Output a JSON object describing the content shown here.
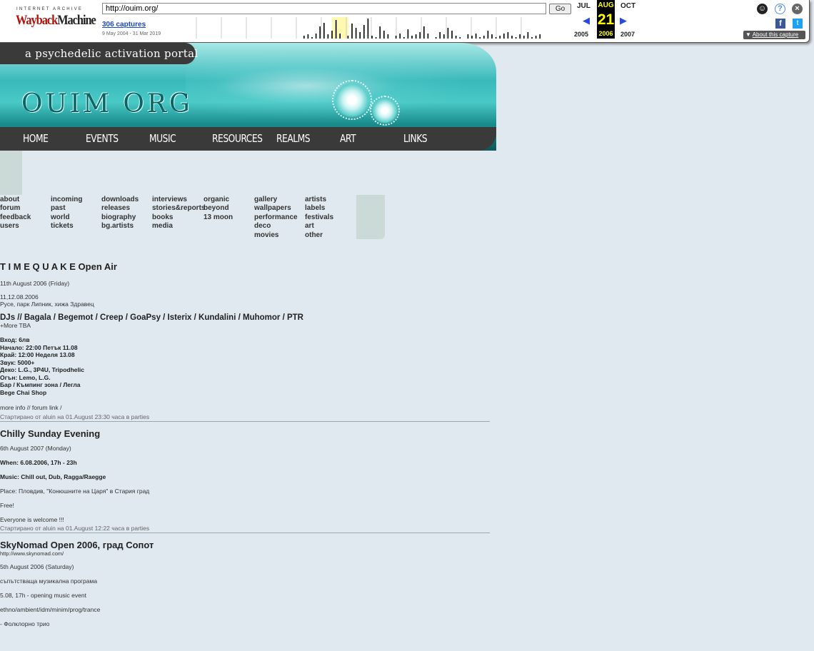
{
  "wayback": {
    "logo_top": "INTERNET ARCHIVE",
    "logo_red": "Wayback",
    "logo_dark": "Machine",
    "url": "http://ouim.org/",
    "go_label": "Go",
    "captures": "306 captures",
    "range": "9 May 2004 - 31 Mar 2019",
    "prev_month": "JUL",
    "cur_month": "AUG",
    "next_month": "OCT",
    "day": "21",
    "prev_year": "2005",
    "cur_year": "2006",
    "next_year": "2007",
    "about": "About this capture",
    "sparkline": [
      2,
      3,
      1,
      4,
      9,
      12,
      3,
      6,
      14,
      4,
      0,
      2,
      11,
      8,
      5,
      10,
      15,
      2,
      1,
      9,
      6,
      3,
      0,
      2,
      4,
      1,
      7,
      2,
      3,
      5,
      9,
      4,
      0,
      1,
      5,
      3,
      8,
      6,
      2,
      1,
      0,
      3,
      2,
      4,
      1,
      2,
      6,
      3,
      1,
      2,
      4,
      5,
      2,
      1,
      3,
      2,
      5,
      1,
      2,
      3
    ]
  },
  "site": {
    "tagline": "a psychedelic activation portal",
    "logo": "OUIM ORG",
    "nav": [
      "HOME",
      "EVENTS",
      "MUSIC",
      "RESOURCES",
      "REALMS",
      "ART",
      "LINKS"
    ]
  },
  "menu": [
    [
      "about",
      "forum",
      "feedback",
      "users"
    ],
    [
      "incoming",
      "past",
      "world",
      "tickets"
    ],
    [
      "downloads",
      "releases",
      "biography",
      "bg.artists"
    ],
    [
      "interviews",
      "stories&reports",
      "books",
      "media"
    ],
    [
      "organic",
      "beyond",
      "13 moon"
    ],
    [
      "gallery",
      "wallpapers",
      "performance",
      "deco",
      "movies"
    ],
    [
      "artists",
      "labels",
      "festivals",
      "art",
      "other"
    ]
  ],
  "posts": [
    {
      "title": "T I M E Q U A K E Open Air",
      "date": "11th August 2006 (Friday)",
      "place_date": "11,12.08.2006",
      "place": "Русе, парк Липник, хижа Здравец",
      "djs": "DJs // Bagala / Begemot / Creep / GoaPsy / Isterix / Kundalini / Muhomor / PTR",
      "more": "+More TBA",
      "info": [
        "Вход: 6лв",
        "Начало: 22:00 Петък 11.08",
        "Край: 12:00 Неделя 13.08",
        "Звук: 5000+",
        "Деко: L.G., 3P4U, Tripodhelic",
        "Огън: Lemo, L.G.",
        "Бар / Къмпинг зона / Легла",
        "Bege Chai Shop"
      ],
      "links": "more info // forum link /",
      "meta": "Стартирано от aluin на 01.August 23:30 часа в parties"
    },
    {
      "title": "Chilly Sunday Evening",
      "date": "6th August 2007 (Monday)",
      "when": "When: 6.08.2006, 17h - 23h",
      "music": "Music: Chill out, Dub, Ragga/Raegge",
      "place": "Place: Пловдив, \"Конюшните на Царя\" в Стария град",
      "free": "Free!",
      "welcome": "Everyone is welcome !!!",
      "meta": "Стартирано от aluin на 01.August 12:22 часа в parties"
    },
    {
      "title": "SkyNomad Open 2006, град Сопот",
      "url": "http://www.skynomad.com/",
      "date": "5th August 2006 (Saturday)",
      "l1": "съпътстваща музикална програма",
      "l2": "5.08, 17h - opening music event",
      "l3": "ethno/ambient/idm/minim/prog/trance",
      "l4": "- Фолклорно трио"
    }
  ]
}
